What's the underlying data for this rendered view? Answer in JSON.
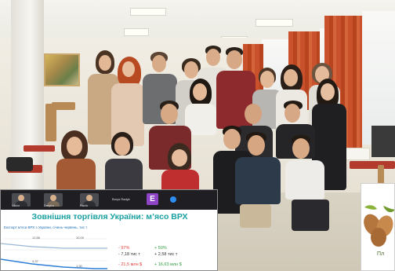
{
  "call_overlay": {
    "participants": [
      {
        "label": "Viktor"
      },
      {
        "label": "Dmytro"
      },
      {
        "label": "Pavlo"
      },
      {
        "label": "Borys Radyk"
      }
    ],
    "avatar_letter": "E",
    "slide": {
      "title": "Зовнішня торгівля України: м’ясо ВРХ",
      "subtitle": "Експорт м’яса ВРХ з України, січень-червень, тис т",
      "chart_labels": [
        "12,86",
        "10,00",
        "4,37",
        "1,30"
      ],
      "stats": {
        "export_pct": "- 97%",
        "export_volume": "- 7,18 тис т",
        "export_value": "- 21,5 млн $",
        "import_pct": "+ 50%",
        "import_volume": "+ 2,58 тис т",
        "import_value": "+ 16,63 млн $"
      }
    },
    "colors": {
      "title": "#1aa0a0",
      "subtitle": "#1e6fb5",
      "negative": "#e53935",
      "positive": "#2e9e3e",
      "avatar": "#8e44c7"
    }
  },
  "side_card": {
    "label": "Пл",
    "icon": "almond-nuts-icon"
  }
}
